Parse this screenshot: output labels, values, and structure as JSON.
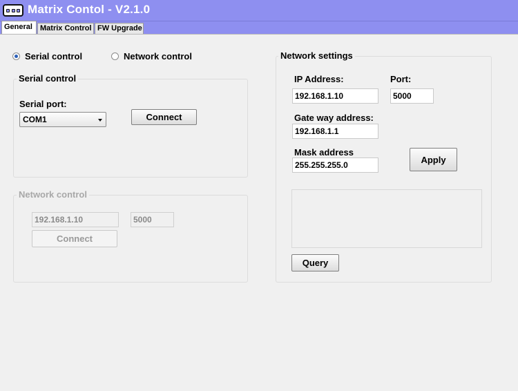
{
  "window": {
    "title": "Matrix Contol - V2.1.0",
    "icon": "matrix-switch-icon"
  },
  "tabs": [
    {
      "label": "General",
      "active": true
    },
    {
      "label": "Matrix Control",
      "active": false
    },
    {
      "label": "FW Upgrade",
      "active": false
    }
  ],
  "mode": {
    "serial_label": "Serial control",
    "network_label": "Network control",
    "selected": "serial"
  },
  "serial_group": {
    "title": "Serial control",
    "port_label": "Serial port:",
    "port_value": "COM1",
    "connect_label": "Connect"
  },
  "network_group": {
    "title": "Network control",
    "ip_value": "192.168.1.10",
    "port_value": "5000",
    "connect_label": "Connect"
  },
  "network_settings": {
    "title": "Network settings",
    "ip_label": "IP Address:",
    "ip_value": "192.168.1.10",
    "port_label": "Port:",
    "port_value": "5000",
    "gateway_label": "Gate way address:",
    "gateway_value": "192.168.1.1",
    "mask_label": "Mask address",
    "mask_value": "255.255.255.0",
    "apply_label": "Apply",
    "query_label": "Query"
  },
  "colors": {
    "titlebar": "#8e8ff0",
    "radio_dot": "#2b5fb8"
  }
}
